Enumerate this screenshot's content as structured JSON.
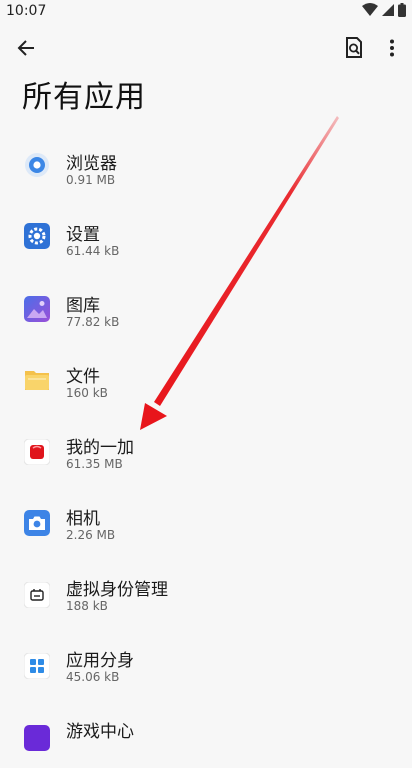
{
  "status_bar": {
    "time": "10:07",
    "icons": [
      "wifi-icon",
      "signal-icon",
      "battery-icon"
    ]
  },
  "app_bar": {
    "back_icon": "back-arrow-icon",
    "search_icon": "search-document-icon",
    "more_icon": "more-vert-icon"
  },
  "page": {
    "title": "所有应用"
  },
  "apps": [
    {
      "name": "浏览器",
      "size": "0.91 MB",
      "icon": "browser-icon"
    },
    {
      "name": "设置",
      "size": "61.44 kB",
      "icon": "settings-gear-icon"
    },
    {
      "name": "图库",
      "size": "77.82 kB",
      "icon": "gallery-icon"
    },
    {
      "name": "文件",
      "size": "160 kB",
      "icon": "folder-icon"
    },
    {
      "name": "我的一加",
      "size": "61.35 MB",
      "icon": "my-oneplus-icon"
    },
    {
      "name": "相机",
      "size": "2.26 MB",
      "icon": "camera-icon"
    },
    {
      "name": "虚拟身份管理",
      "size": "188 kB",
      "icon": "virtual-identity-icon"
    },
    {
      "name": "应用分身",
      "size": "45.06 kB",
      "icon": "app-clone-icon"
    },
    {
      "name": "游戏中心",
      "size": "",
      "icon": "game-center-icon"
    }
  ],
  "colors": {
    "accent_blue": "#3a7be8",
    "arrow_red": "#e8151b",
    "background": "#f7f7f7"
  }
}
